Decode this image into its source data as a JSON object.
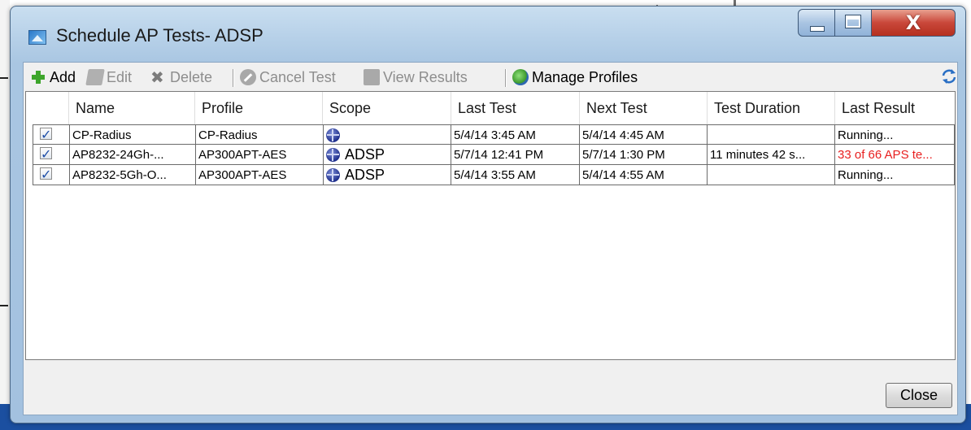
{
  "window": {
    "title": "Schedule AP Tests- ADSP",
    "close_glyph": "X"
  },
  "toolbar": {
    "add_label": "Add",
    "edit_label": "Edit",
    "delete_label": "Delete",
    "cancel_test_label": "Cancel Test",
    "view_results_label": "View Results",
    "manage_profiles_label": "Manage Profiles"
  },
  "table": {
    "columns": [
      "Name",
      "Profile",
      "Scope",
      "Last Test",
      "Next Test",
      "Test Duration",
      "Last Result"
    ],
    "rows": [
      {
        "checked": true,
        "name": "CP-Radius",
        "profile": "CP-Radius",
        "scope": "",
        "last_test": "5/4/14 3:45 AM",
        "next_test": "5/4/14 4:45 AM",
        "duration": "",
        "result": "Running..."
      },
      {
        "checked": true,
        "name": "AP8232-24Gh-...",
        "profile": "AP300APT-AES",
        "scope": "ADSP",
        "last_test": "5/7/14 12:41 PM",
        "next_test": "5/7/14 1:30 PM",
        "duration": "11 minutes 42 s...",
        "result": "33 of 66 APS te..."
      },
      {
        "checked": true,
        "name": "AP8232-5Gh-O...",
        "profile": "AP300APT-AES",
        "scope": "ADSP",
        "last_test": "5/4/14 3:55 AM",
        "next_test": "5/4/14 4:55 AM",
        "duration": "",
        "result": "Running..."
      }
    ]
  },
  "footer": {
    "close_label": "Close"
  },
  "colors": {
    "error_text": "#e82020",
    "add_icon": "#3da52b",
    "title_close_button": "#c9473a"
  },
  "icons": [
    "add-icon",
    "edit-icon",
    "delete-icon",
    "cancel-icon",
    "view-results-icon",
    "manage-profiles-icon",
    "refresh-icon",
    "globe-icon"
  ]
}
